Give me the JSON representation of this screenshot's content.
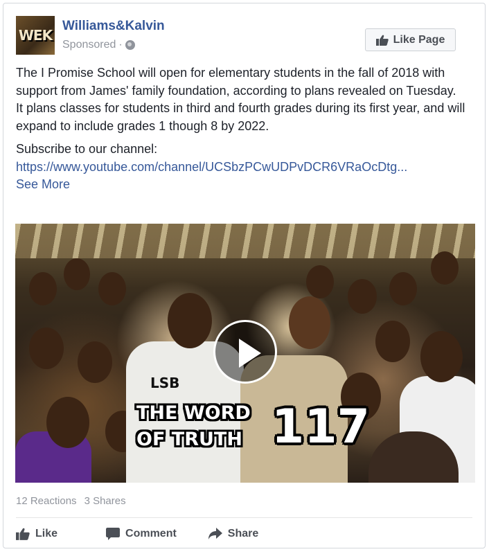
{
  "post": {
    "page_name": "Williams&Kalvin",
    "sponsored_label": "Sponsored",
    "separator": "·",
    "avatar_text": "WEK",
    "like_page_label": "Like Page"
  },
  "body": {
    "paragraph1": "The I Promise School will open for elementary students in the fall of 2018 with support from James' family foundation, according to plans revealed on Tuesday.",
    "paragraph2": "It plans classes for students in third and fourth grades during its first year, and will expand to include grades 1 though 8 by 2022.",
    "subscribe_label": "Subscribe to our channel:",
    "link_text": "https://www.youtube.com/channel/UCSbzPCwUDPvDCR6VRaOcDtg...",
    "see_more": "See More"
  },
  "video": {
    "overlay_line1": "THE WORD",
    "overlay_line2": "OF TRUTH",
    "overlay_number": "117",
    "shirt_text": "LSB"
  },
  "stats": {
    "reactions": "12 Reactions",
    "shares": "3 Shares"
  },
  "actions": {
    "like": "Like",
    "comment": "Comment",
    "share": "Share"
  },
  "colors": {
    "link": "#365899",
    "meta": "#90949c",
    "action": "#4b4f56"
  }
}
